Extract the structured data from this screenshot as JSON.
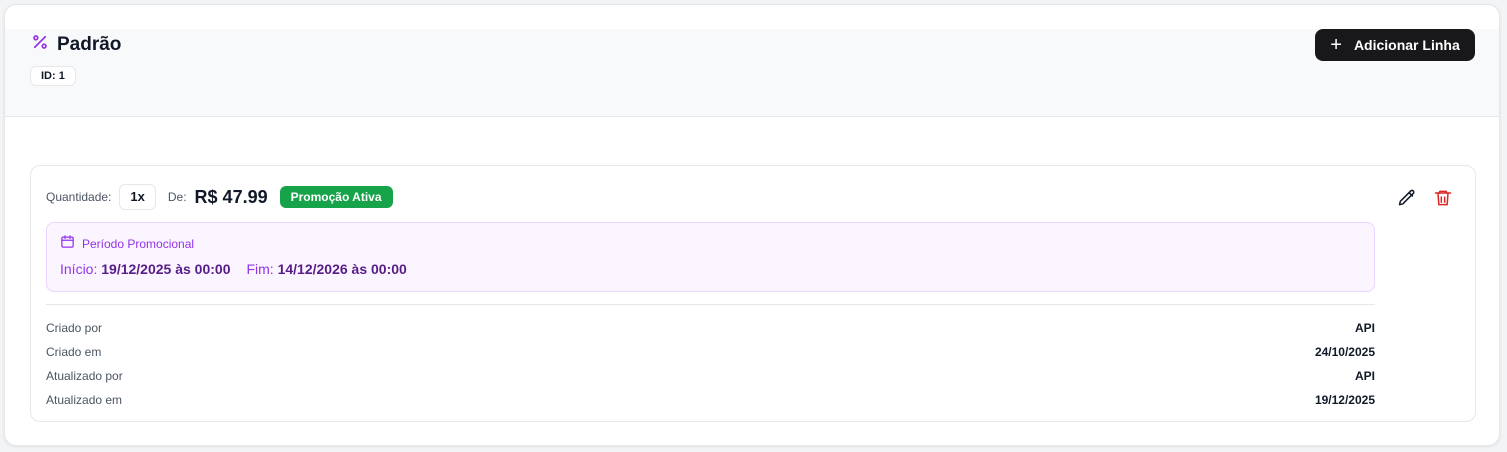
{
  "header": {
    "title": "Padrão",
    "id_badge": "ID: 1",
    "add_button_label": "Adicionar Linha",
    "title_icon": "percent-icon"
  },
  "line": {
    "quantity_label": "Quantidade:",
    "quantity_value": "1x",
    "de_label": "De:",
    "price": "R$ 47.99",
    "status_badge": "Promoção Ativa",
    "promo": {
      "title": "Período Promocional",
      "start_label": "Início:",
      "start_value": "19/12/2025 às 00:00",
      "end_label": "Fim:",
      "end_value": "14/12/2026 às 00:00"
    },
    "meta": [
      {
        "label": "Criado por",
        "value": "API"
      },
      {
        "label": "Criado em",
        "value": "24/10/2025"
      },
      {
        "label": "Atualizado por",
        "value": "API"
      },
      {
        "label": "Atualizado em",
        "value": "19/12/2025"
      }
    ]
  },
  "colors": {
    "accent": "#9333ea",
    "success": "#16a34a",
    "danger": "#dc2626",
    "button_dark": "#18181b"
  }
}
